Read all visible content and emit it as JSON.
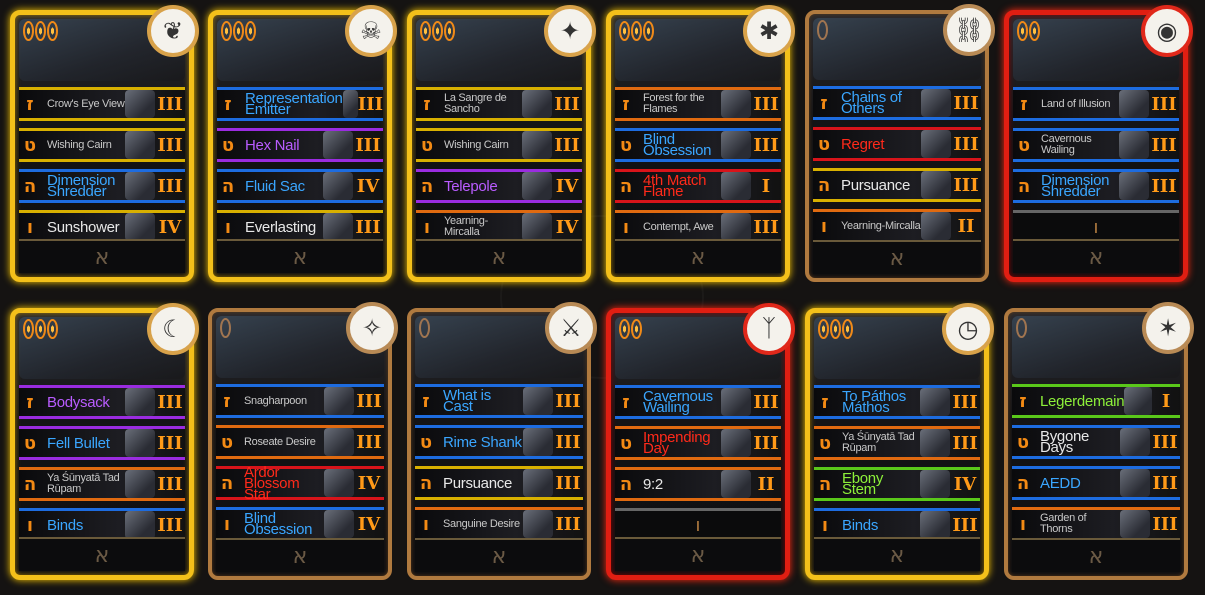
{
  "cards": [
    {
      "border": "gold",
      "pips": 3,
      "emblem": "wing-icon",
      "slots": [
        {
          "glyph": "ז",
          "name": "Crow's Eye View",
          "rank": "III",
          "color": "yellow",
          "text": ""
        },
        {
          "glyph": "ט",
          "name": "Wishing Cairn",
          "rank": "III",
          "color": "yellow",
          "text": ""
        },
        {
          "glyph": "ה",
          "name": "Dimension Shredder",
          "rank": "III",
          "color": "blue",
          "text": "blue"
        },
        {
          "glyph": "ו",
          "name": "Sunshower",
          "rank": "IV",
          "color": "yellow",
          "text": "big"
        }
      ],
      "aleph": "א"
    },
    {
      "border": "gold",
      "pips": 3,
      "emblem": "skull-icon",
      "slots": [
        {
          "glyph": "ז",
          "name": "Representation Emitter",
          "rank": "III",
          "color": "blue",
          "text": "blue"
        },
        {
          "glyph": "ט",
          "name": "Hex Nail",
          "rank": "III",
          "color": "purple",
          "text": "purple"
        },
        {
          "glyph": "ה",
          "name": "Fluid Sac",
          "rank": "IV",
          "color": "blue",
          "text": "blue"
        },
        {
          "glyph": "ו",
          "name": "Everlasting",
          "rank": "III",
          "color": "yellow",
          "text": "big"
        }
      ],
      "aleph": "א"
    },
    {
      "border": "gold",
      "pips": 3,
      "emblem": "star-icon",
      "slots": [
        {
          "glyph": "ז",
          "name": "La Sangre de Sancho",
          "rank": "III",
          "color": "yellow",
          "text": ""
        },
        {
          "glyph": "ט",
          "name": "Wishing Cairn",
          "rank": "III",
          "color": "yellow",
          "text": ""
        },
        {
          "glyph": "ה",
          "name": "Telepole",
          "rank": "IV",
          "color": "purple",
          "text": "purple"
        },
        {
          "glyph": "ו",
          "name": "Yearning-Mircalla",
          "rank": "IV",
          "color": "orange",
          "text": ""
        }
      ],
      "aleph": "א"
    },
    {
      "border": "gold",
      "pips": 3,
      "emblem": "kanji-icon",
      "slots": [
        {
          "glyph": "ז",
          "name": "Forest for the Flames",
          "rank": "III",
          "color": "orange",
          "text": ""
        },
        {
          "glyph": "ט",
          "name": "Blind Obsession",
          "rank": "III",
          "color": "blue",
          "text": "blue"
        },
        {
          "glyph": "ה",
          "name": "4th Match Flame",
          "rank": "I",
          "color": "red",
          "text": "red"
        },
        {
          "glyph": "ו",
          "name": "Contempt, Awe",
          "rank": "III",
          "color": "orange",
          "text": ""
        }
      ],
      "aleph": "א"
    },
    {
      "border": "bronze",
      "pips": 1,
      "emblem": "chain-icon",
      "slots": [
        {
          "glyph": "ז",
          "name": "Chains of Others",
          "rank": "III",
          "color": "blue",
          "text": "blue"
        },
        {
          "glyph": "ט",
          "name": "Regret",
          "rank": "III",
          "color": "red",
          "text": "red"
        },
        {
          "glyph": "ה",
          "name": "Pursuance",
          "rank": "III",
          "color": "yellow",
          "text": "big"
        },
        {
          "glyph": "ו",
          "name": "Yearning-Mircalla",
          "rank": "II",
          "color": "orange",
          "text": ""
        }
      ],
      "aleph": "א"
    },
    {
      "border": "red",
      "pips": 2,
      "emblem": "eye-icon",
      "slots": [
        {
          "glyph": "ז",
          "name": "Land of Illusion",
          "rank": "III",
          "color": "blue",
          "text": ""
        },
        {
          "glyph": "ט",
          "name": "Cavernous Wailing",
          "rank": "III",
          "color": "blue",
          "text": ""
        },
        {
          "glyph": "ה",
          "name": "Dimension Shredder",
          "rank": "III",
          "color": "blue",
          "text": "blue"
        },
        {
          "glyph": "ו",
          "name": "",
          "rank": "",
          "color": "empty",
          "text": ""
        }
      ],
      "aleph": "א"
    },
    {
      "border": "gold",
      "pips": 3,
      "emblem": "hood-icon",
      "slots": [
        {
          "glyph": "ז",
          "name": "Bodysack",
          "rank": "III",
          "color": "purple",
          "text": "purple"
        },
        {
          "glyph": "ט",
          "name": "Fell Bullet",
          "rank": "III",
          "color": "purple",
          "text": "blue"
        },
        {
          "glyph": "ה",
          "name": "Ya Śūnyatā Tad Rūpam",
          "rank": "III",
          "color": "orange",
          "text": ""
        },
        {
          "glyph": "ו",
          "name": "Binds",
          "rank": "III",
          "color": "blue",
          "text": "blue"
        }
      ],
      "aleph": "א"
    },
    {
      "border": "bronze",
      "pips": 1,
      "emblem": "compass-icon",
      "slots": [
        {
          "glyph": "ז",
          "name": "Snagharpoon",
          "rank": "III",
          "color": "blue",
          "text": ""
        },
        {
          "glyph": "ט",
          "name": "Roseate Desire",
          "rank": "III",
          "color": "orange",
          "text": ""
        },
        {
          "glyph": "ה",
          "name": "Ardor Blossom Star",
          "rank": "IV",
          "color": "red",
          "text": "red"
        },
        {
          "glyph": "ו",
          "name": "Blind Obsession",
          "rank": "IV",
          "color": "blue",
          "text": "blue"
        }
      ],
      "aleph": "א"
    },
    {
      "border": "bronze",
      "pips": 1,
      "emblem": "blade-icon",
      "slots": [
        {
          "glyph": "ז",
          "name": "What is Cast",
          "rank": "III",
          "color": "blue",
          "text": "blue"
        },
        {
          "glyph": "ט",
          "name": "Rime Shank",
          "rank": "III",
          "color": "blue",
          "text": "blue"
        },
        {
          "glyph": "ה",
          "name": "Pursuance",
          "rank": "III",
          "color": "yellow",
          "text": "big"
        },
        {
          "glyph": "ו",
          "name": "Sanguine Desire",
          "rank": "III",
          "color": "orange",
          "text": ""
        }
      ],
      "aleph": "א"
    },
    {
      "border": "red",
      "pips": 2,
      "emblem": "rune-icon",
      "slots": [
        {
          "glyph": "ז",
          "name": "Cavernous Wailing",
          "rank": "III",
          "color": "blue",
          "text": "blue"
        },
        {
          "glyph": "ט",
          "name": "Impending Day",
          "rank": "III",
          "color": "orange",
          "text": "red"
        },
        {
          "glyph": "ה",
          "name": "9:2",
          "rank": "II",
          "color": "orange",
          "text": "big"
        },
        {
          "glyph": "ו",
          "name": "",
          "rank": "",
          "color": "empty",
          "text": ""
        }
      ],
      "aleph": "א"
    },
    {
      "border": "gold",
      "pips": 3,
      "emblem": "watch-icon",
      "slots": [
        {
          "glyph": "ז",
          "name": "To Páthos Máthos",
          "rank": "III",
          "color": "blue",
          "text": "blue"
        },
        {
          "glyph": "ט",
          "name": "Ya Śūnyatā Tad Rūpam",
          "rank": "III",
          "color": "orange",
          "text": ""
        },
        {
          "glyph": "ה",
          "name": "Ebony Stem",
          "rank": "IV",
          "color": "green",
          "text": "green"
        },
        {
          "glyph": "ו",
          "name": "Binds",
          "rank": "III",
          "color": "blue",
          "text": "blue"
        }
      ],
      "aleph": "א"
    },
    {
      "border": "bronze",
      "pips": 1,
      "emblem": "crow-icon",
      "slots": [
        {
          "glyph": "ז",
          "name": "Legerdemain",
          "rank": "I",
          "color": "green",
          "text": "green"
        },
        {
          "glyph": "ט",
          "name": "Bygone Days",
          "rank": "III",
          "color": "blue",
          "text": "big"
        },
        {
          "glyph": "ה",
          "name": "AEDD",
          "rank": "III",
          "color": "blue",
          "text": "blue"
        },
        {
          "glyph": "ו",
          "name": "Garden of Thorns",
          "rank": "III",
          "color": "orange",
          "text": ""
        }
      ],
      "aleph": "א"
    }
  ]
}
